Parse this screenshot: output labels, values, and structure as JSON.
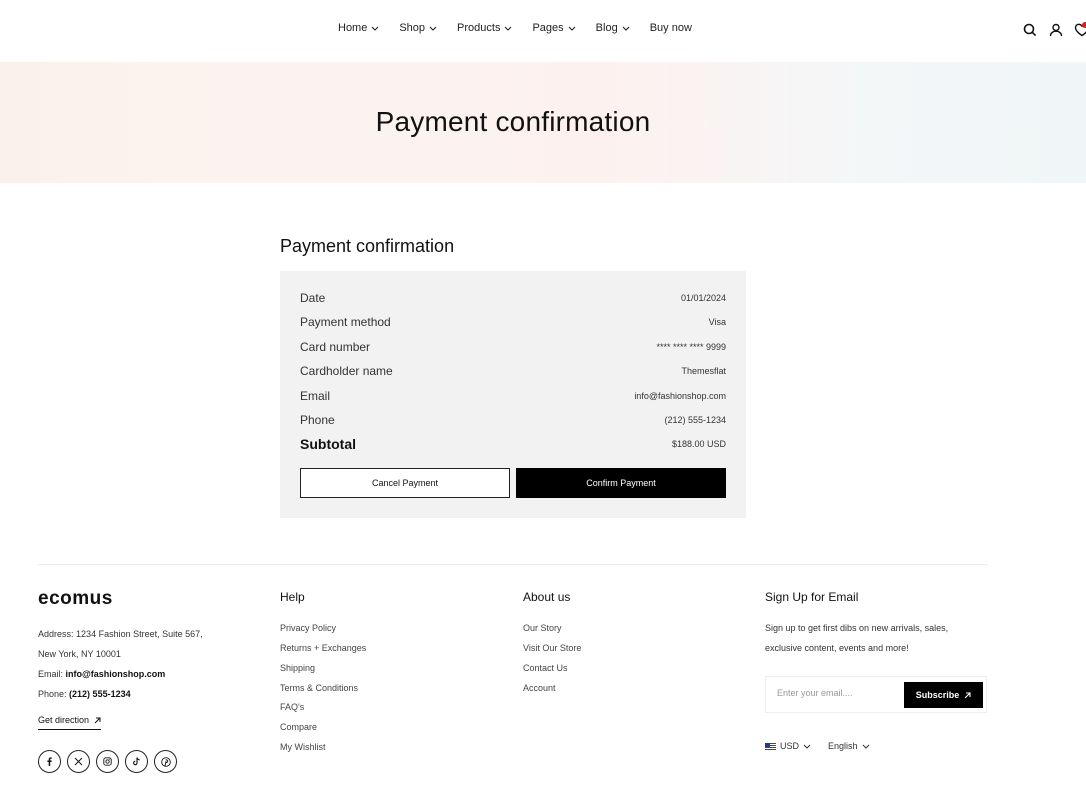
{
  "nav": {
    "items": [
      {
        "label": "Home",
        "has_dropdown": true
      },
      {
        "label": "Shop",
        "has_dropdown": true
      },
      {
        "label": "Products",
        "has_dropdown": true
      },
      {
        "label": "Pages",
        "has_dropdown": true
      },
      {
        "label": "Blog",
        "has_dropdown": true
      },
      {
        "label": "Buy now",
        "has_dropdown": false
      }
    ],
    "icons": [
      "search-icon",
      "user-icon",
      "heart-icon"
    ]
  },
  "hero": {
    "title": "Payment confirmation"
  },
  "payment": {
    "title": "Payment confirmation",
    "rows": [
      {
        "label": "Date",
        "value": "01/01/2024"
      },
      {
        "label": "Payment method",
        "value": "Visa"
      },
      {
        "label": "Card number",
        "value": "**** **** **** 9999"
      },
      {
        "label": "Cardholder name",
        "value": "Themesflat"
      },
      {
        "label": "Email",
        "value": "info@fashionshop.com"
      },
      {
        "label": "Phone",
        "value": "(212) 555-1234"
      },
      {
        "label": "Subtotal",
        "value": "$188.00 USD"
      }
    ],
    "cancel_label": "Cancel Payment",
    "confirm_label": "Confirm Payment"
  },
  "footer": {
    "logo": "ecomus",
    "address_label": "Address:",
    "address_value": "1234 Fashion Street, Suite 567,",
    "address_line2": "New York, NY 10001",
    "email_label": "Email:",
    "email_value": "info@fashionshop.com",
    "phone_label": "Phone:",
    "phone_value": "(212) 555-1234",
    "get_direction": "Get direction",
    "socials": [
      "facebook-icon",
      "x-icon",
      "instagram-icon",
      "tiktok-icon",
      "pinterest-icon"
    ],
    "help": {
      "title": "Help",
      "links": [
        "Privacy Policy",
        "Returns + Exchanges",
        "Shipping",
        "Terms & Conditions",
        "FAQ's",
        "Compare",
        "My Wishlist"
      ]
    },
    "about": {
      "title": "About us",
      "links": [
        "Our Story",
        "Visit Our Store",
        "Contact Us",
        "Account"
      ]
    },
    "signup": {
      "title": "Sign Up for Email",
      "text_line1": "Sign up to get first dibs on new arrivals, sales,",
      "text_line2": "exclusive content, events and more!",
      "placeholder": "Enter your email....",
      "button": "Subscribe"
    },
    "currency": "USD",
    "language": "English"
  },
  "colors": {
    "accent": "#000000",
    "card_bg": "#f2f2f2",
    "badge": "#e31b23"
  }
}
